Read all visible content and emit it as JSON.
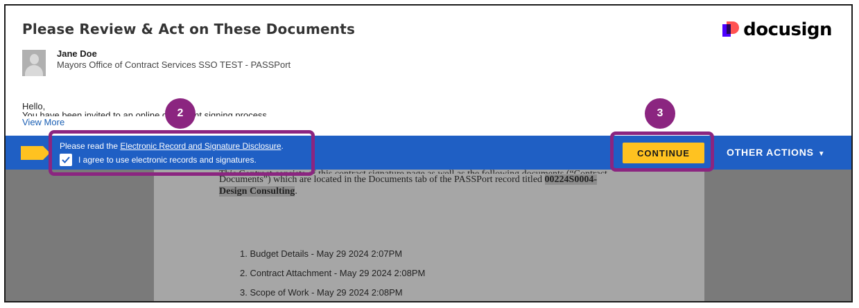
{
  "header": {
    "title": "Please Review & Act on These Documents",
    "logo_text": "docusign",
    "logo_colors": [
      "#4c00ff",
      "#ff5252",
      "#26065d"
    ]
  },
  "sender": {
    "name": "Jane Doe",
    "org": "Mayors Office of Contract Services SSO TEST - PASSPort"
  },
  "message": {
    "greeting": "Hello,",
    "body": "You have been invited to an online document signing process",
    "view_more": "View More"
  },
  "action_bar": {
    "color": "#1f5fc4",
    "disclosure_prefix": "Please read the ",
    "disclosure_link": "Electronic Record and Signature Disclosure",
    "disclosure_suffix": ".",
    "agree_label": "I agree to use electronic records and signatures.",
    "agree_checked": true,
    "continue_label": "CONTINUE",
    "continue_color": "#ffc220",
    "other_actions_label": "OTHER ACTIONS"
  },
  "document": {
    "para_line1": "This Contract consists of this contract signature page as well as the following documents (“Contract",
    "para_line2": "Documents”) which are located in the Documents tab of the PASSPort record titled ",
    "para_record": "00224S0004-",
    "para_line3": "Design Consulting",
    "para_line3_suffix": ".",
    "items": [
      "1.  Budget Details - May 29 2024 2:07PM",
      "2.  Contract Attachment - May 29 2024 2:08PM",
      "3.  Scope of Work - May 29 2024 2:08PM"
    ]
  },
  "annotations": {
    "color": "#8b2580",
    "badge_2": "2",
    "badge_3": "3"
  }
}
